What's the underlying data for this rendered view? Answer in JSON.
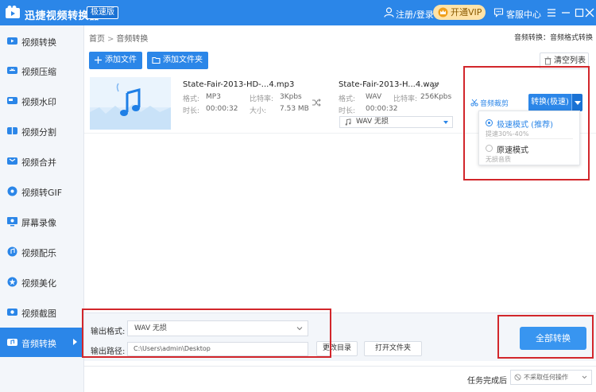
{
  "app": {
    "title": "迅捷视频转换器",
    "edition": "极速版",
    "login": "注册/登录",
    "vip_button": "开通VIP",
    "customer_service": "客服中心",
    "window_controls": [
      "menu-icon",
      "minimize-icon",
      "maximize-icon",
      "close-icon"
    ]
  },
  "sidebar": {
    "items": [
      {
        "label": "视频转换",
        "icon": "video-convert-icon"
      },
      {
        "label": "视频压缩",
        "icon": "compress-icon"
      },
      {
        "label": "视频水印",
        "icon": "watermark-icon"
      },
      {
        "label": "视频分割",
        "icon": "split-icon"
      },
      {
        "label": "视频合并",
        "icon": "merge-icon"
      },
      {
        "label": "视频转GIF",
        "icon": "gif-icon"
      },
      {
        "label": "屏幕录像",
        "icon": "screen-record-icon"
      },
      {
        "label": "视频配乐",
        "icon": "music-icon"
      },
      {
        "label": "视频美化",
        "icon": "beautify-icon"
      },
      {
        "label": "视频截图",
        "icon": "screenshot-icon"
      },
      {
        "label": "音频转换",
        "icon": "audio-convert-icon",
        "active": true
      }
    ]
  },
  "breadcrumb": {
    "home": "首页",
    "separator": ">",
    "current": "音频转换"
  },
  "status_right": "音频转换：音频格式转换",
  "toolbar": {
    "add_file": "添加文件",
    "add_folder": "添加文件夹",
    "clear_list": "清空列表"
  },
  "file": {
    "source": {
      "name": "State-Fair-2013-HD-...4.mp3",
      "format_label": "格式:",
      "format": "MP3",
      "bitrate_label": "比特率:",
      "bitrate": "3Kpbs",
      "duration_label": "时长:",
      "duration": "00:00:32",
      "size_label": "大小:",
      "size": "7.53 MB"
    },
    "output": {
      "name": "State-Fair-2013-H...4.wav",
      "format_label": "格式:",
      "format": "WAV",
      "bitrate_label": "比特率:",
      "bitrate": "256Kpbs",
      "duration_label": "时长:",
      "duration": "00:00:32",
      "select_value": "WAV  无损"
    },
    "clip_link": "音频裁剪",
    "convert_button": "转换(极速)"
  },
  "dropdown": {
    "options": [
      {
        "title": "极速模式 (推荐)",
        "sub": "提速30%-40%",
        "selected": true
      },
      {
        "title": "原速模式",
        "sub": "无损音质",
        "selected": false
      }
    ]
  },
  "bottom": {
    "output_format_label": "输出格式:",
    "output_format_value": "WAV  无损",
    "output_path_label": "输出路径:",
    "output_path_value": "C:\\Users\\admin\\Desktop",
    "change_dir": "更改目录",
    "open_folder": "打开文件夹",
    "convert_all": "全部转换"
  },
  "footer": {
    "task_label": "任务完成后",
    "task_value": "不采取任何操作"
  },
  "colors": {
    "accent": "#2b86e8",
    "highlight": "#d2262b",
    "vip": "#ffe3a8"
  }
}
